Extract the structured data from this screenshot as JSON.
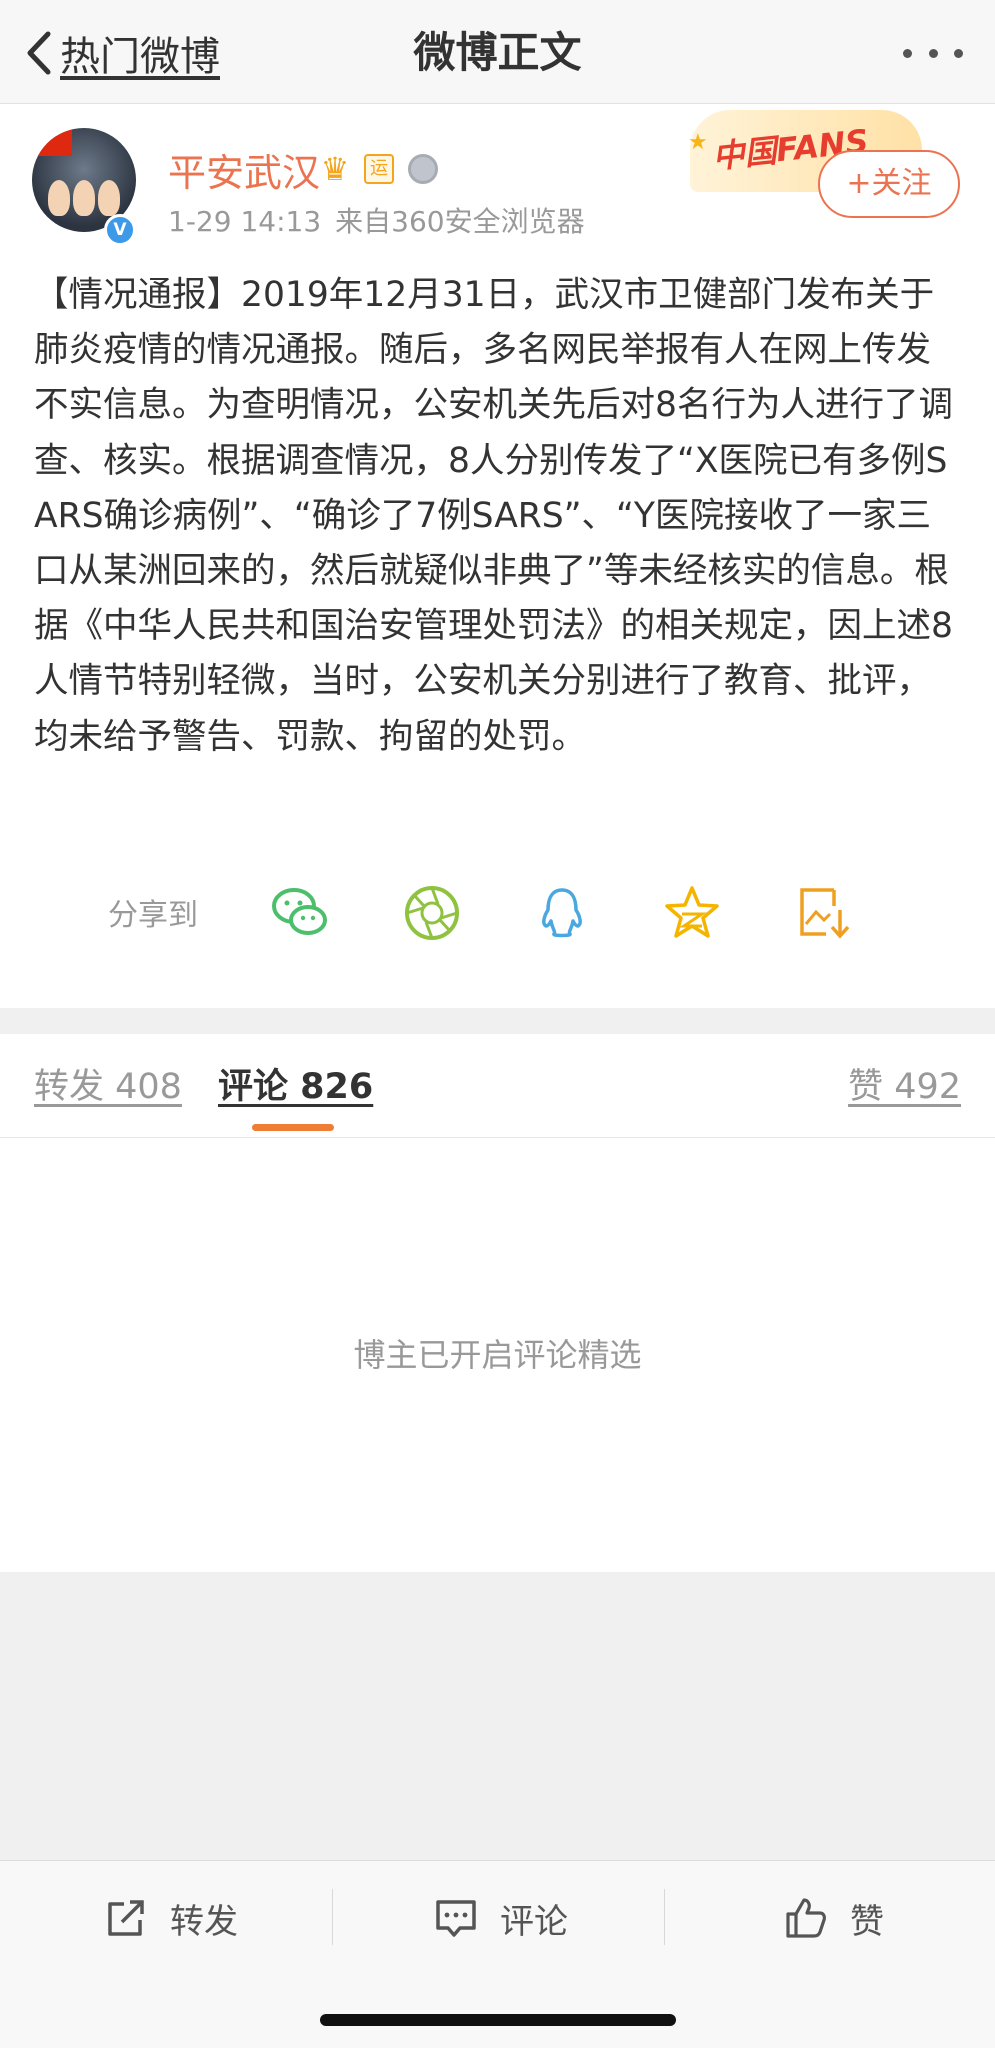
{
  "nav": {
    "back_label": "热门微博",
    "title": "微博正文",
    "more_icon": "ellipsis-icon"
  },
  "user": {
    "name": "平安武汉",
    "badge_yun": "运",
    "time": "1-29 14:13",
    "source": "来自360安全浏览器",
    "follow_label": "+关注",
    "banner_text": "中国FANS",
    "verified": true
  },
  "post": {
    "text": "【情况通报】2019年12月31日，武汉市卫健部门发布关于肺炎疫情的情况通报。随后，多名网民举报有人在网上传发不实信息。为查明情况，公安机关先后对8名行为人进行了调查、核实。根据调查情况，8人分别传发了“X医院已有多例SARS确诊病例”、“确诊了7例SARS”、“Y医院接收了一家三口从某洲回来的，然后就疑似非典了”等未经核实的信息。根据《中华人民共和国治安管理处罚法》的相关规定，因上述8人情节特别轻微，当时，公安机关分别进行了教育、批评，均未给予警告、罚款、拘留的处罚。"
  },
  "share": {
    "label": "分享到",
    "targets": [
      "wechat-icon",
      "moments-icon",
      "qq-icon",
      "qzone-icon",
      "save-image-icon"
    ]
  },
  "tabs": {
    "repost": "转发 408",
    "comment": "评论 826",
    "like": "赞 492",
    "active": "comment"
  },
  "comments": {
    "message": "博主已开启评论精选"
  },
  "actions": {
    "repost": "转发",
    "comment": "评论",
    "like": "赞"
  },
  "colors": {
    "accent": "#eb7350",
    "tab_indicator": "#f07d34",
    "wechat": "#4bbf6b",
    "moments": "#8fc23f",
    "qq": "#4aa8e0",
    "qzone": "#f4b400"
  }
}
